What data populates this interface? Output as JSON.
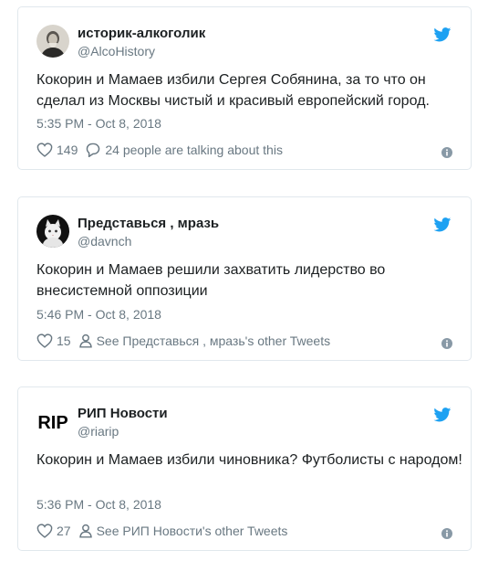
{
  "tweets": [
    {
      "name": "историк-алкоголик",
      "handle": "@AlcoHistory",
      "text": "Кокорин и Мамаев избили Сергея Собянина, за то что он сделал из Москвы чистый и красивый европейский город.",
      "time": "5:35 PM - Oct 8, 2018",
      "likes": "149",
      "secondary": "24 people are talking about this",
      "secondary_icon": "comment-icon"
    },
    {
      "name": "Представься , мразь",
      "handle": "@davnch",
      "text": "Кокорин и Мамаев решили захватить лидерство во внесистемной оппозиции",
      "time": "5:46 PM - Oct 8, 2018",
      "likes": "15",
      "secondary": "See Представься , мразь's other Tweets",
      "secondary_icon": "person-icon"
    },
    {
      "name": "РИП Новости",
      "handle": "@riarip",
      "text": "Кокорин и Мамаев избили чиновника? Футболисты с народом!",
      "time": "5:36 PM - Oct 8, 2018",
      "likes": "27",
      "secondary": "See РИП Новости's other Tweets",
      "secondary_icon": "person-icon",
      "avatar_text": "RIP"
    }
  ],
  "colors": {
    "twitter_blue": "#1da1f2",
    "meta_gray": "#697882",
    "border": "#e1e8ed"
  }
}
